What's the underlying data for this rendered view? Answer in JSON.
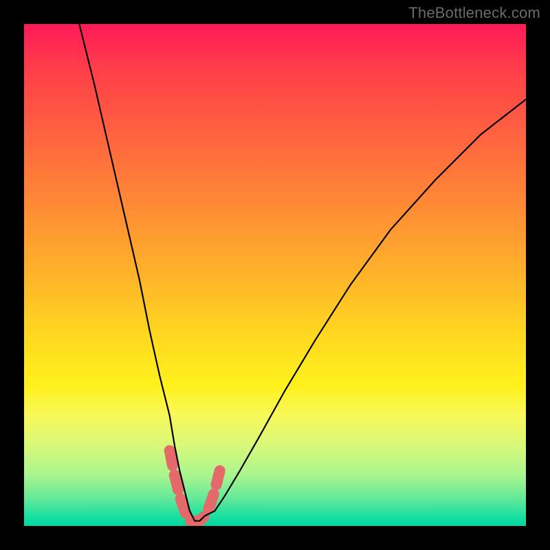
{
  "watermark": {
    "text": "TheBottleneck.com"
  },
  "colors": {
    "frame": "#000000",
    "curve": "#000000",
    "highlight": "#e46a6a",
    "gradient_stops": [
      "#ff1a58",
      "#ff3b4a",
      "#ff6340",
      "#ff8a35",
      "#ffb32a",
      "#ffd820",
      "#fff11c",
      "#f8f85a",
      "#d8f87a",
      "#a8f58e",
      "#5ce79a",
      "#1be0a0",
      "#00d7a0"
    ]
  },
  "chart_data": {
    "type": "line",
    "title": "",
    "xlabel": "",
    "ylabel": "",
    "x_range_pct": [
      0,
      100
    ],
    "y_range_pct": [
      0,
      100
    ],
    "notes": "No axis ticks or numeric labels are rendered; values are read as percentages of the plot area (x: 0=left, 100=right; y: 0=bottom, 100=top). The curve is a V-shaped bottleneck profile with its minimum near x≈34%. A dashed pink highlight marks the near-zero trough region.",
    "series": [
      {
        "name": "bottleneck-curve",
        "x": [
          11,
          14,
          17,
          20,
          23,
          25,
          27,
          29,
          30,
          31,
          32,
          33,
          34,
          35,
          36,
          38,
          40,
          43,
          47,
          52,
          58,
          65,
          73,
          82,
          91,
          100
        ],
        "y": [
          100,
          88,
          75,
          62,
          49,
          39,
          30,
          22,
          16,
          11,
          7,
          3,
          1,
          1,
          2,
          3,
          6,
          11,
          18,
          27,
          37,
          48,
          59,
          69,
          78,
          85
        ]
      }
    ],
    "highlight": {
      "name": "trough-marker",
      "x": [
        29,
        30,
        31,
        32,
        33,
        34,
        35,
        36,
        37,
        38,
        39
      ],
      "y": [
        15,
        10,
        6,
        3,
        1,
        1,
        1,
        2,
        4,
        7,
        11
      ]
    }
  }
}
